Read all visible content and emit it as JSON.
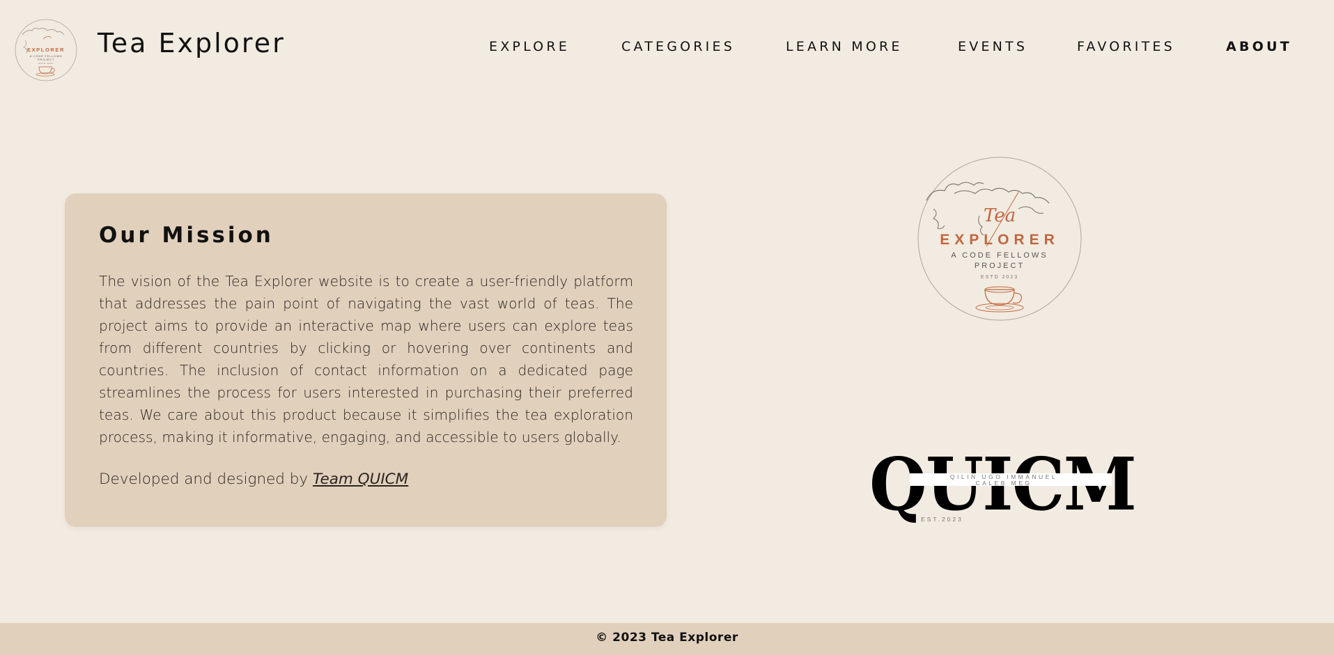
{
  "header": {
    "logo": {
      "word": "EXPLORER",
      "subtitle": "A CODE FELLOWS",
      "subtitle2": "PROJECT",
      "established": "ESTD 2023"
    },
    "title": "Tea Explorer",
    "nav": [
      {
        "label": "EXPLORE"
      },
      {
        "label": "CATEGORIES"
      },
      {
        "label": "LEARN MORE"
      },
      {
        "label": "EVENTS"
      },
      {
        "label": "FAVORITES"
      },
      {
        "label": "ABOUT",
        "active": true
      }
    ]
  },
  "mission": {
    "title": "Our Mission",
    "body": "The vision of the Tea Explorer website is to create a user-friendly platform that addresses the pain point of navigating the vast world of teas. The project aims to provide an interactive map where users can explore teas from different countries by clicking or hovering over continents and countries. The inclusion of contact information on a dedicated page streamlines the process for users interested in purchasing their preferred teas. We care about this product because it simplifies the tea exploration process, making it informative, engaging, and accessible to users globally.",
    "credit_prefix": "Developed and designed by",
    "credit_link": "Team QUICM"
  },
  "brand_logo": {
    "script": "Tea",
    "word": "EXPLORER",
    "line1": "A CODE FELLOWS",
    "line2": "PROJECT",
    "established": "ESTD 2023"
  },
  "team_logo": {
    "wordmark": "QUICM",
    "members_line1": "QILIN UGO IMMANUEL",
    "members_line2": "CALEB MEG",
    "established": "EST.2023"
  },
  "footer": {
    "copyright": "© 2023 Tea Explorer"
  },
  "colors": {
    "background": "#f2ebe1",
    "card": "#e1d0bc",
    "accent": "#c0673f",
    "text": "#111111"
  }
}
